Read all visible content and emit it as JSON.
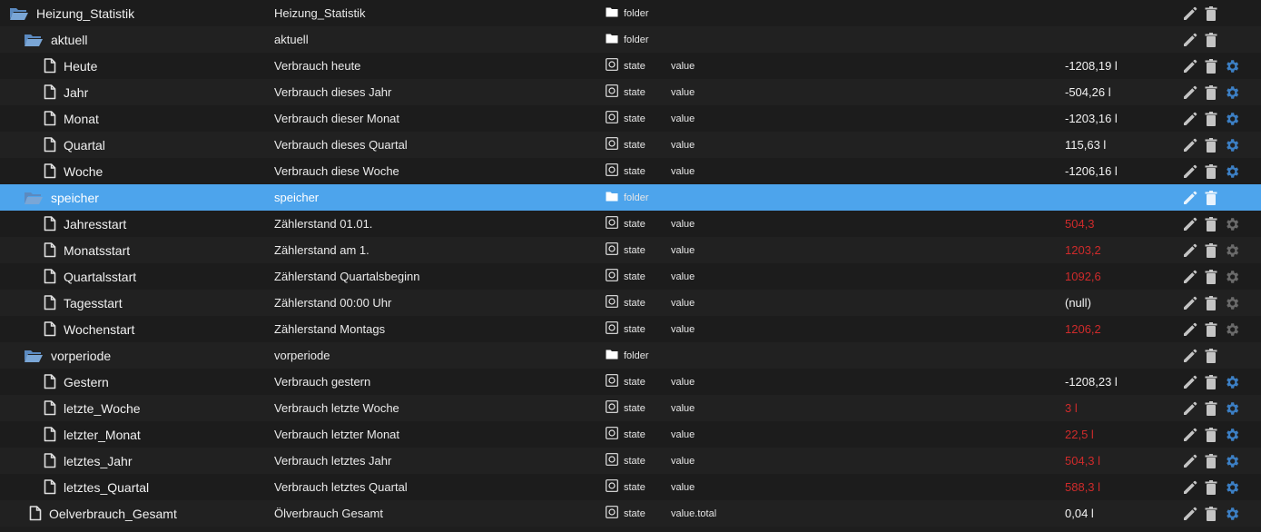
{
  "colors": {
    "background": "#1e1e1e",
    "selected_row": "#4da4ec",
    "error_value": "#cf2b2b",
    "folder_icon": "#6e9ccc",
    "gear_active": "#3c7fc4",
    "gear_inactive": "#6a6a6a"
  },
  "rows": [
    {
      "id": "Heizung_Statistik",
      "icon": "folder-open-icon",
      "indent": 0,
      "name": "Heizung_Statistik",
      "type": "folder",
      "role": "",
      "value": "",
      "value_error": false,
      "gear": "none",
      "selected": false
    },
    {
      "id": "aktuell",
      "icon": "folder-open-icon",
      "indent": 1,
      "name": "aktuell",
      "type": "folder",
      "role": "",
      "value": "",
      "value_error": false,
      "gear": "none",
      "selected": false
    },
    {
      "id": "Heute",
      "icon": "file-icon",
      "indent": 2,
      "name": "Verbrauch heute",
      "type": "state",
      "role": "value",
      "value": "-1208,19 l",
      "value_error": false,
      "gear": "active",
      "selected": false
    },
    {
      "id": "Jahr",
      "icon": "file-icon",
      "indent": 2,
      "name": "Verbrauch dieses Jahr",
      "type": "state",
      "role": "value",
      "value": "-504,26 l",
      "value_error": false,
      "gear": "active",
      "selected": false
    },
    {
      "id": "Monat",
      "icon": "file-icon",
      "indent": 2,
      "name": "Verbrauch dieser Monat",
      "type": "state",
      "role": "value",
      "value": "-1203,16 l",
      "value_error": false,
      "gear": "active",
      "selected": false
    },
    {
      "id": "Quartal",
      "icon": "file-icon",
      "indent": 2,
      "name": "Verbrauch dieses Quartal",
      "type": "state",
      "role": "value",
      "value": "115,63 l",
      "value_error": false,
      "gear": "active",
      "selected": false
    },
    {
      "id": "Woche",
      "icon": "file-icon",
      "indent": 2,
      "name": "Verbrauch diese Woche",
      "type": "state",
      "role": "value",
      "value": "-1206,16 l",
      "value_error": false,
      "gear": "active",
      "selected": false
    },
    {
      "id": "speicher",
      "icon": "folder-open-icon",
      "indent": 1,
      "name": "speicher",
      "type": "folder",
      "role": "",
      "value": "",
      "value_error": false,
      "gear": "none",
      "selected": true
    },
    {
      "id": "Jahresstart",
      "icon": "file-icon",
      "indent": 2,
      "name": "Zählerstand 01.01.",
      "type": "state",
      "role": "value",
      "value": "504,3",
      "value_error": true,
      "gear": "inactive",
      "selected": false
    },
    {
      "id": "Monatsstart",
      "icon": "file-icon",
      "indent": 2,
      "name": "Zählerstand am 1.",
      "type": "state",
      "role": "value",
      "value": "1203,2",
      "value_error": true,
      "gear": "inactive",
      "selected": false
    },
    {
      "id": "Quartalsstart",
      "icon": "file-icon",
      "indent": 2,
      "name": "Zählerstand Quartalsbeginn",
      "type": "state",
      "role": "value",
      "value": "1092,6",
      "value_error": true,
      "gear": "inactive",
      "selected": false
    },
    {
      "id": "Tagesstart",
      "icon": "file-icon",
      "indent": 2,
      "name": "Zählerstand 00:00 Uhr",
      "type": "state",
      "role": "value",
      "value": "(null)",
      "value_error": false,
      "gear": "inactive",
      "selected": false
    },
    {
      "id": "Wochenstart",
      "icon": "file-icon",
      "indent": 2,
      "name": "Zählerstand Montags",
      "type": "state",
      "role": "value",
      "value": "1206,2",
      "value_error": true,
      "gear": "inactive",
      "selected": false
    },
    {
      "id": "vorperiode",
      "icon": "folder-open-icon",
      "indent": 1,
      "name": "vorperiode",
      "type": "folder",
      "role": "",
      "value": "",
      "value_error": false,
      "gear": "none",
      "selected": false
    },
    {
      "id": "Gestern",
      "icon": "file-icon",
      "indent": 2,
      "name": "Verbrauch gestern",
      "type": "state",
      "role": "value",
      "value": "-1208,23 l",
      "value_error": false,
      "gear": "active",
      "selected": false
    },
    {
      "id": "letzte_Woche",
      "icon": "file-icon",
      "indent": 2,
      "name": "Verbrauch letzte Woche",
      "type": "state",
      "role": "value",
      "value": "3 l",
      "value_error": true,
      "gear": "active",
      "selected": false
    },
    {
      "id": "letzter_Monat",
      "icon": "file-icon",
      "indent": 2,
      "name": "Verbrauch letzter Monat",
      "type": "state",
      "role": "value",
      "value": "22,5 l",
      "value_error": true,
      "gear": "active",
      "selected": false
    },
    {
      "id": "letztes_Jahr",
      "icon": "file-icon",
      "indent": 2,
      "name": "Verbrauch letztes Jahr",
      "type": "state",
      "role": "value",
      "value": "504,3 l",
      "value_error": true,
      "gear": "active",
      "selected": false
    },
    {
      "id": "letztes_Quartal",
      "icon": "file-icon",
      "indent": 2,
      "name": "Verbrauch letztes Quartal",
      "type": "state",
      "role": "value",
      "value": "588,3 l",
      "value_error": true,
      "gear": "active",
      "selected": false
    },
    {
      "id": "Oelverbrauch_Gesamt",
      "icon": "file-icon",
      "indent": 1,
      "name": "Ölverbrauch Gesamt",
      "type": "state",
      "role": "value.total",
      "value": "0,04 l",
      "value_error": false,
      "gear": "active",
      "selected": false
    }
  ]
}
